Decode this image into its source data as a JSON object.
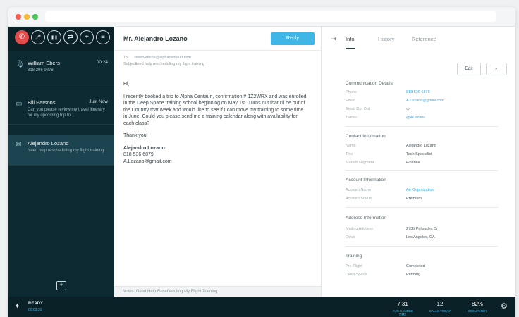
{
  "header": {
    "contact_name": "Mr. Alejandro Lozano",
    "reply_label": "Reply"
  },
  "controls": [
    {
      "icon": "end-call-icon",
      "glyph": "✆"
    },
    {
      "icon": "mute-icon",
      "glyph": "🎤"
    },
    {
      "icon": "pause-icon",
      "glyph": "❚❚"
    },
    {
      "icon": "transfer-icon",
      "glyph": "⇄"
    },
    {
      "icon": "add-icon",
      "glyph": "+"
    },
    {
      "icon": "menu-icon",
      "glyph": "≡"
    }
  ],
  "conversations": [
    {
      "icon": "microphone-icon",
      "glyph": "🎙",
      "name": "William Ebers",
      "time": "00:24",
      "sub": "818 296 9878"
    },
    {
      "icon": "chat-icon",
      "glyph": "▭",
      "name": "Bill Parsons",
      "time": "Just Now",
      "sub": "Can you please review my travel itinerary for my upcoming trip to..."
    },
    {
      "icon": "email-icon",
      "glyph": "✉",
      "name": "Alejandro Lozano",
      "time": "",
      "sub": "Need help rescheduling my flight training"
    }
  ],
  "email": {
    "from_label": "To:",
    "from_value": "reservations@alphacentauri.com",
    "subject_label": "Subject:",
    "subject_value": "Need help rescheduling my flight training",
    "greeting": "Hi,",
    "paragraph": "I recently booked a trip to Alpha Centauri, confirmation # 1Z2WRX and was enrolled in the Deep Space training school beginning on May 1st. Turns out that I'll be out of the Country that week and would like to see if I can move my training to some time in June. Could you please send me a training calendar along with availability for each class?",
    "thanks": "Thank you!",
    "sig_name": "Alejandro Lozano",
    "sig_phone": "818 536 6879",
    "sig_email": "A.Lozano@gmail.com",
    "notes": "Notes: Need Help Rescheduling My Flight Training"
  },
  "right_panel": {
    "tabs": [
      "Info",
      "History",
      "Reference"
    ],
    "edit_label": "Edit",
    "sections": [
      {
        "title": "Communication Details",
        "fields": [
          {
            "label": "Phone",
            "value": "818 536 6879",
            "link": true
          },
          {
            "label": "Email",
            "value": "A.Lozano@gmail.com",
            "link": true
          },
          {
            "label": "Email Opt Out",
            "value": "○",
            "link": false
          },
          {
            "label": "Twitter",
            "value": "@ALozano",
            "link": true
          }
        ]
      },
      {
        "title": "Contact Information",
        "fields": [
          {
            "label": "Name",
            "value": "Alejandro Lozano",
            "link": false
          },
          {
            "label": "Title",
            "value": "Tech Specialist",
            "link": false
          },
          {
            "label": "Market Segment",
            "value": "Finance",
            "link": false
          }
        ]
      },
      {
        "title": "Account Information",
        "fields": [
          {
            "label": "Account Name",
            "value": "An Organization",
            "link": true
          },
          {
            "label": "Account Status",
            "value": "Premium",
            "link": false
          }
        ]
      },
      {
        "title": "Address Information",
        "fields": [
          {
            "label": "Mailing Address",
            "value": "2735 Palisades Dr",
            "link": false
          },
          {
            "label": "Other",
            "value": "Los Angeles, CA",
            "link": false
          }
        ]
      },
      {
        "title": "Training",
        "fields": [
          {
            "label": "Pre-Flight",
            "value": "Completed",
            "link": false
          },
          {
            "label": "Deep Space",
            "value": "Pending",
            "link": false
          }
        ]
      }
    ]
  },
  "status_bar": {
    "state": "READY",
    "timer": "00:02:31",
    "stats": [
      {
        "value": "7:31",
        "caption": "AVG HANDLE TIME"
      },
      {
        "value": "12",
        "caption": "CALLS TODAY"
      },
      {
        "value": "82%",
        "caption": "OCCUPANCY"
      }
    ]
  },
  "colors": {
    "accent": "#3fb6e6",
    "panel_dark": "#0d2a32",
    "end_call": "#e24b4b"
  }
}
